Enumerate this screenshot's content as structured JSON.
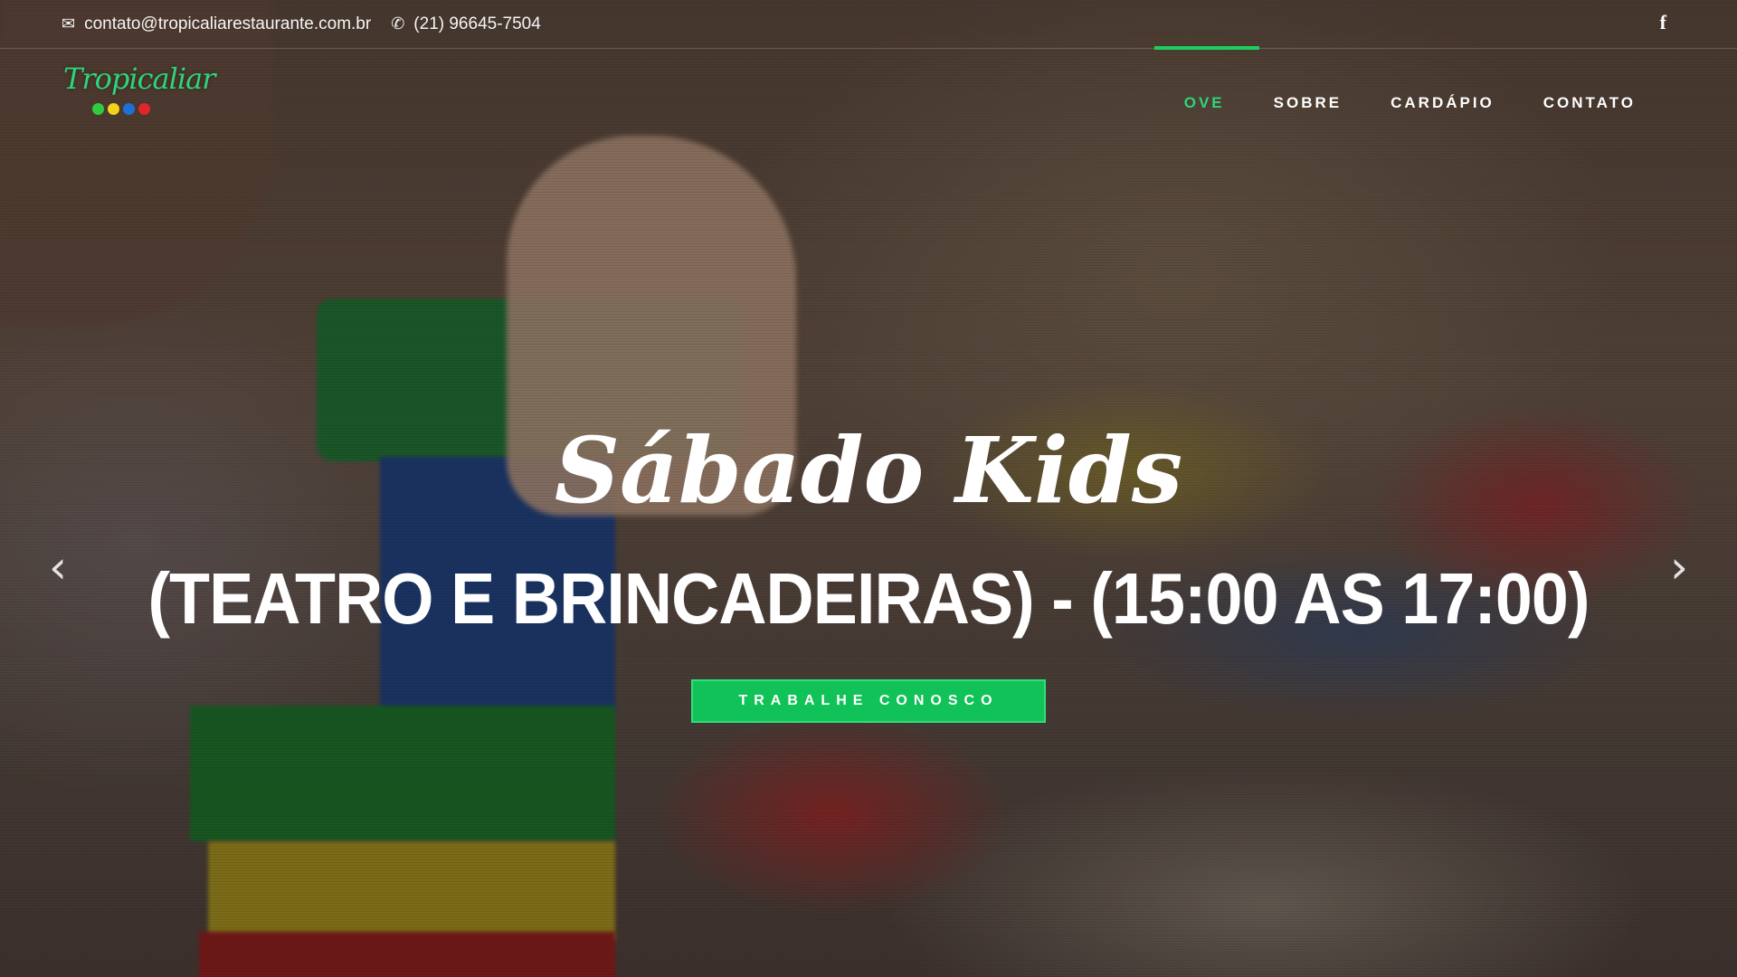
{
  "topbar": {
    "email_icon": "envelope-icon",
    "email": "contato@tropicaliarestaurante.com.br",
    "phone_icon": "phone-icon",
    "phone": "(21) 96645-7504",
    "social_icon": "facebook-icon",
    "social_glyph": "f"
  },
  "logo": {
    "text": "Tropicaliar",
    "dot_colors": [
      "#2ecc40",
      "#f2d21b",
      "#1e6fd9",
      "#e0262b"
    ]
  },
  "nav": {
    "items": [
      {
        "label": "OVE",
        "active": true
      },
      {
        "label": "SOBRE",
        "active": false
      },
      {
        "label": "CARDÁPIO",
        "active": false
      },
      {
        "label": "CONTATO",
        "active": false
      }
    ],
    "accent_color": "#1ccf5f"
  },
  "slide": {
    "title": "Sábado Kids",
    "subtitle": "(TEATRO E BRINCADEIRAS) - (15:00 AS 17:00)",
    "cta_label": "TRABALHE CONOSCO",
    "prev_icon": "chevron-left-icon",
    "next_icon": "chevron-right-icon"
  }
}
